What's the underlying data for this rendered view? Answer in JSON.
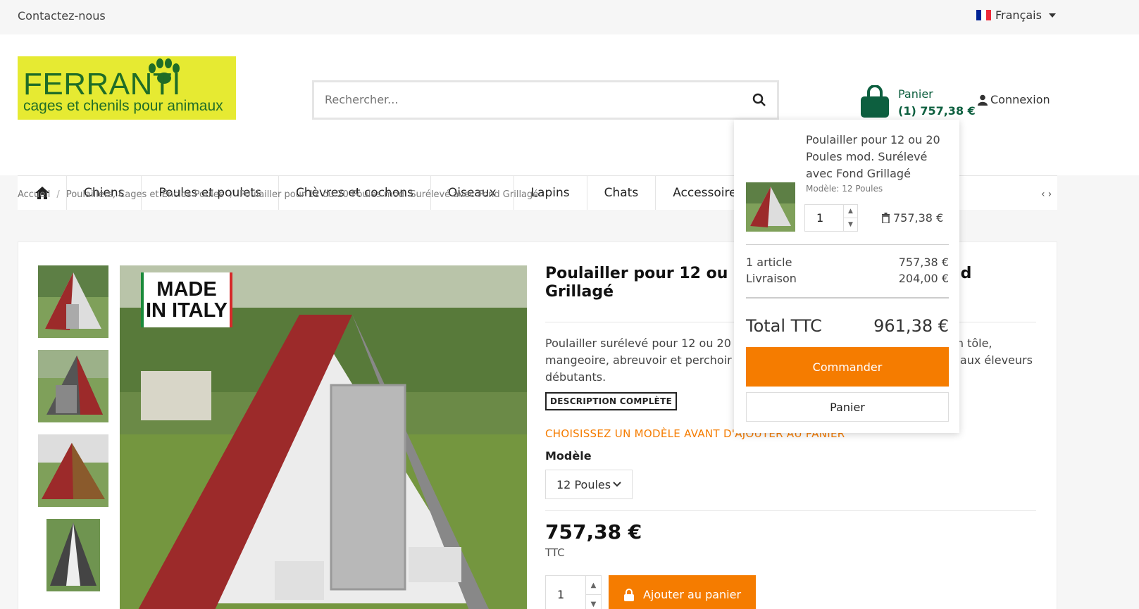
{
  "topbar": {
    "contact": "Contactez-nous",
    "language": "Français"
  },
  "logo": {
    "name": "FERRANTI",
    "tagline": "cages et chenils pour animaux"
  },
  "search": {
    "placeholder": "Rechercher..."
  },
  "cart": {
    "label": "Panier",
    "summary": "(1) 757,38 €"
  },
  "login": {
    "label": "Connexion"
  },
  "nav": {
    "items": [
      "Chiens",
      "Poules et poulets",
      "Chèvres et cochons",
      "Oiseaux",
      "Lapins",
      "Chats",
      "Accessoires"
    ]
  },
  "breadcrumb": [
    "Accueil",
    "Poulaillers, Cages et Enclos Poules",
    "Poulailler pour 12 ou 20 Poules mod. Surélevé avec Fond Grillagé"
  ],
  "badge": {
    "line1": "MADE",
    "line2": "IN ITALY"
  },
  "product": {
    "title_line1": "Poulailler pour 12 ou 20 I",
    "title_line1_end": "nd",
    "title_line2": "Grillagé",
    "desc_line1_start": "Poulailler surélevé pour 12 ou 20 po",
    "desc_line1_end": "en tôle,",
    "desc_line2_start": "mangeoire, abreuvoir et perchoir inc",
    "desc_line2_end": "é aux éleveurs",
    "desc_line3": "débutants.",
    "desc_button": "DESCRIPTION COMPLÈTE",
    "choose_start": "CHOISISSEZ UN MODÈLE AVANT D'AJ",
    "choose_end": "OUTER AU PANIER",
    "model_label": "Modèle",
    "model_value": "12 Poules",
    "price": "757,38 €",
    "tax": "TTC",
    "quantity": "1",
    "add_to_cart": "Ajouter au panier"
  },
  "popup": {
    "product_name": "Poulailler pour 12 ou 20 Poules mod. Surélevé avec Fond Grillagé",
    "model": "Modèle: 12 Poules",
    "quantity": "1",
    "line_price": "757,38 €",
    "articles_label": "1 article",
    "articles_value": "757,38 €",
    "shipping_label": "Livraison",
    "shipping_value": "204,00 €",
    "total_label": "Total TTC",
    "total_value": "961,38 €",
    "checkout": "Commander",
    "cart": "Panier"
  },
  "colors": {
    "accent": "#f57c00",
    "brand_green": "#0d5f3f",
    "logo_yellow": "#e6ea32"
  }
}
